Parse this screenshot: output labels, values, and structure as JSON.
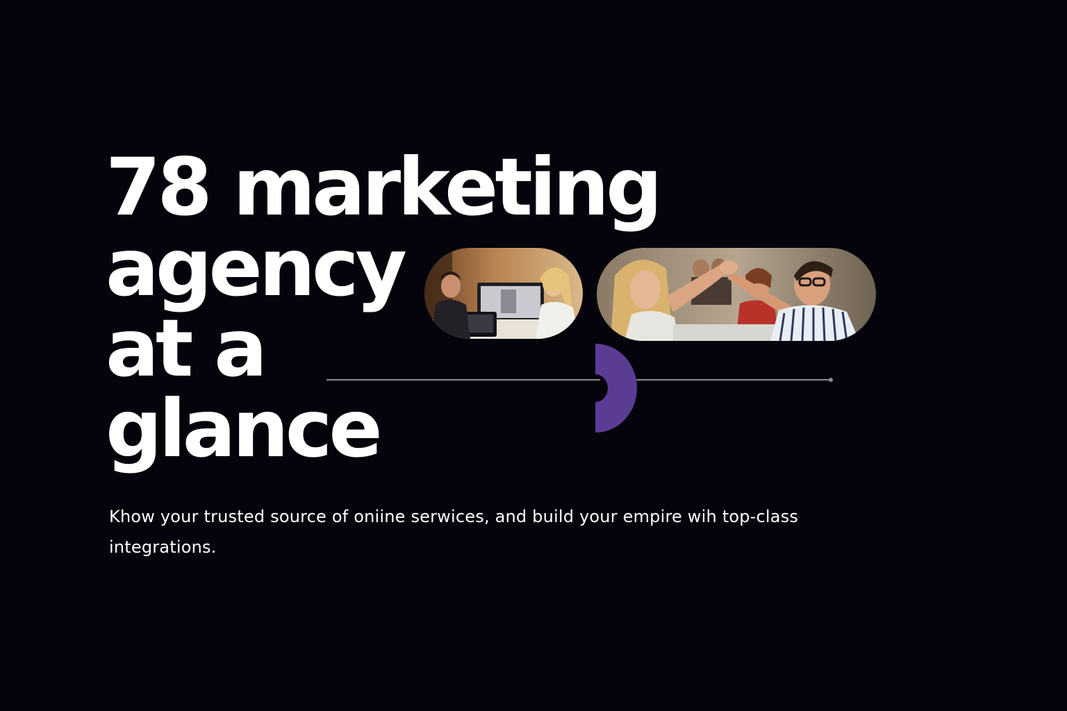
{
  "hero": {
    "title_lines": [
      "78 marketing",
      "agency",
      "at a",
      "glance"
    ],
    "subtitle": "Khow your trusted source of oniine serwices, and build your empire wih top-class integrations."
  },
  "images": [
    {
      "name": "office-meeting-photo",
      "alt": "Colleagues working at a computer in an office"
    },
    {
      "name": "team-high-five-photo",
      "alt": "Team celebrating with a high five"
    }
  ],
  "colors": {
    "background": "#05040c",
    "text": "#ffffff",
    "accent": "#5b3c95",
    "divider": "#8c8a94"
  }
}
